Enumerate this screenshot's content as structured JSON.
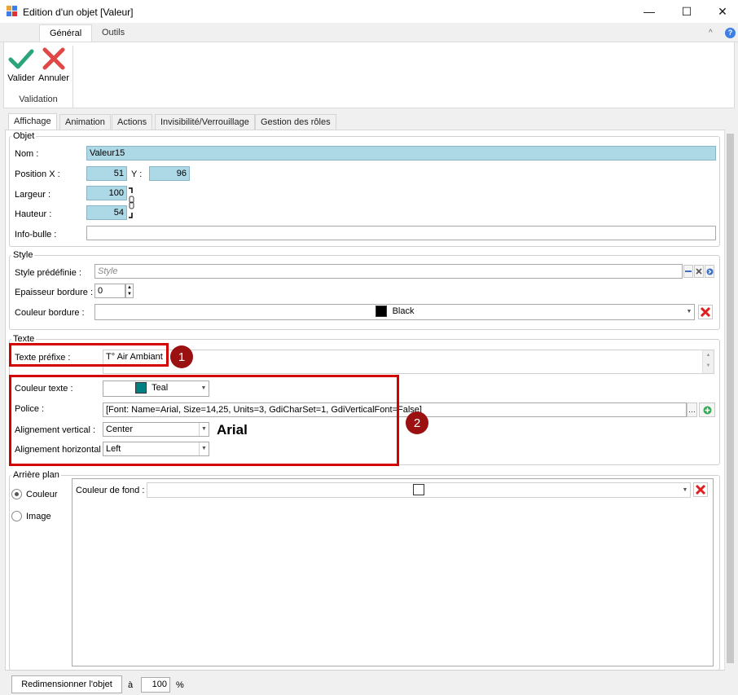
{
  "window": {
    "title": "Edition d'un objet [Valeur]",
    "minimize": "—",
    "maximize": "☐",
    "close": "✕"
  },
  "ribbon": {
    "tabs": [
      "Général",
      "Outils"
    ],
    "buttons": {
      "validate": "Valider",
      "cancel": "Annuler"
    },
    "group_label": "Validation",
    "collapse_icon": "^",
    "help_icon": "?"
  },
  "tabs": [
    "Affichage",
    "Animation",
    "Actions",
    "Invisibilité/Verrouillage",
    "Gestion des rôles"
  ],
  "objet": {
    "title": "Objet",
    "name_label": "Nom :",
    "name_value": "Valeur15",
    "posx_label": "Position X :",
    "posx_value": "51",
    "y_label": "Y :",
    "y_value": "96",
    "width_label": "Largeur :",
    "width_value": "100",
    "height_label": "Hauteur :",
    "height_value": "54",
    "tooltip_label": "Info-bulle :",
    "tooltip_value": ""
  },
  "style": {
    "title": "Style",
    "predefined_label": "Style prédéfinie :",
    "predefined_placeholder": "Style",
    "border_thickness_label": "Epaisseur bordure :",
    "border_thickness_value": "0",
    "border_color_label": "Couleur bordure :",
    "border_color_value": "Black",
    "border_color_hex": "#000000"
  },
  "texte": {
    "title": "Texte",
    "prefix_label": "Texte préfixe :",
    "prefix_value": "T° Air Ambiant",
    "color_label": "Couleur texte :",
    "color_value": "Teal",
    "color_hex": "#008080",
    "font_label": "Police :",
    "font_value": "[Font: Name=Arial, Size=14,25, Units=3, GdiCharSet=1, GdiVerticalFont=False]",
    "valign_label": "Alignement vertical :",
    "valign_value": "Center",
    "halign_label": "Alignement horizontal :",
    "halign_value": "Left",
    "preview": "Arial"
  },
  "background": {
    "title": "Arrière plan",
    "radio_color": "Couleur",
    "radio_image": "Image",
    "color_label": "Couleur de fond :"
  },
  "callouts": [
    "1",
    "2"
  ],
  "footer": {
    "resize_button": "Redimensionner l'objet",
    "a_label": "à",
    "percent_value": "100",
    "percent_sign": "%"
  },
  "colors": {
    "accent_red": "#d40000",
    "badge": "#9b1010",
    "field_blue": "#add8e6"
  }
}
